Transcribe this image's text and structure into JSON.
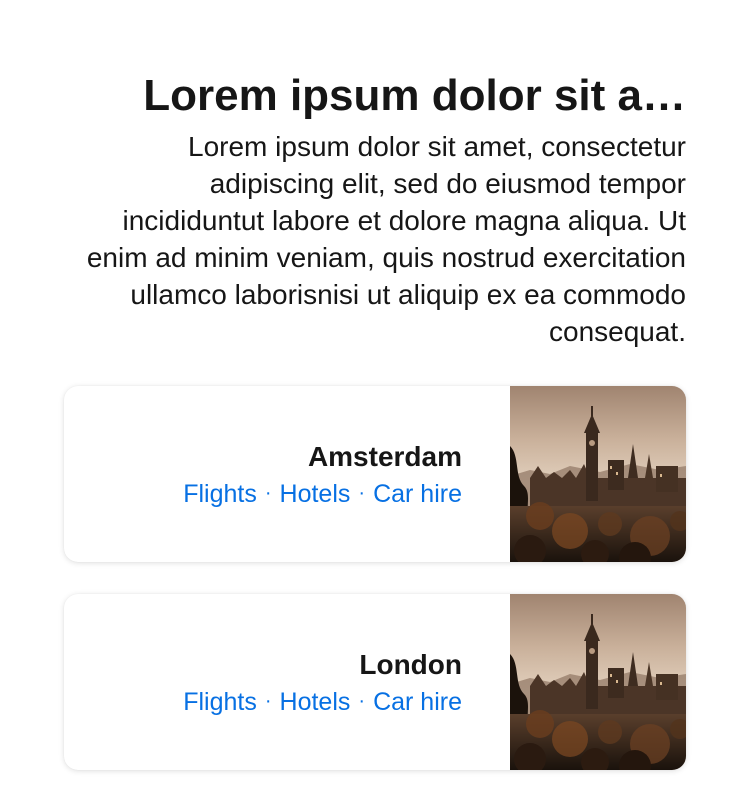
{
  "header": {
    "title": "Lorem ipsum dolor sit a…",
    "description": "Lorem ipsum dolor sit amet, consectetur adipiscing elit, sed do eiusmod tempor incididuntut labore et dolore magna aliqua. Ut enim ad minim veniam, quis nostrud exercitation ullamco laborisnisi ut aliquip ex ea commodo consequat."
  },
  "cards": [
    {
      "title": "Amsterdam",
      "links": [
        "Flights",
        "Hotels",
        "Car hire"
      ],
      "separator": "·",
      "image_icon": "city-skyline-photo"
    },
    {
      "title": "London",
      "links": [
        "Flights",
        "Hotels",
        "Car hire"
      ],
      "separator": "·",
      "image_icon": "city-skyline-photo"
    }
  ],
  "colors": {
    "link": "#0770e3",
    "text": "#161616",
    "card_bg": "#ffffff"
  }
}
